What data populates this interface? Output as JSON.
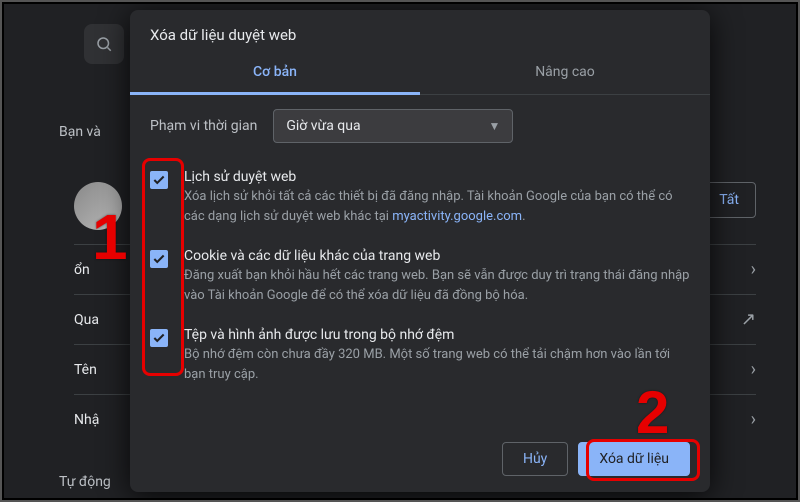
{
  "background": {
    "sidebar_heading": "Bạn và",
    "btn_right": "Tất",
    "rows": [
      {
        "label": "ổn"
      },
      {
        "label": "Qua"
      },
      {
        "label": "Tên"
      },
      {
        "label": "Nhậ"
      }
    ],
    "footer": "Tự động"
  },
  "dialog": {
    "title": "Xóa dữ liệu duyệt web",
    "tabs": {
      "basic": "Cơ bản",
      "advanced": "Nâng cao"
    },
    "time_range": {
      "label": "Phạm vi thời gian",
      "selected": "Giờ vừa qua"
    },
    "options": [
      {
        "title": "Lịch sử duyệt web",
        "desc_before": "Xóa lịch sử khỏi tất cả các thiết bị đã đăng nhập. Tài khoản Google của bạn có thể có các dạng lịch sử duyệt web khác tại ",
        "link": "myactivity.google.com",
        "desc_after": "."
      },
      {
        "title": "Cookie và các dữ liệu khác của trang web",
        "desc_before": "Đăng xuất bạn khỏi hầu hết các trang web. Bạn sẽ vẫn được duy trì trạng thái đăng nhập vào Tài khoản Google để có thể xóa dữ liệu đã đồng bộ hóa.",
        "link": "",
        "desc_after": ""
      },
      {
        "title": "Tệp và hình ảnh được lưu trong bộ nhớ đệm",
        "desc_before": "Bộ nhớ đệm còn chưa đầy 320 MB. Một số trang web có thể tải chậm hơn vào lần tới bạn truy cập.",
        "link": "",
        "desc_after": ""
      }
    ],
    "buttons": {
      "cancel": "Hủy",
      "confirm": "Xóa dữ liệu"
    }
  },
  "annotations": {
    "one": "1",
    "two": "2"
  }
}
